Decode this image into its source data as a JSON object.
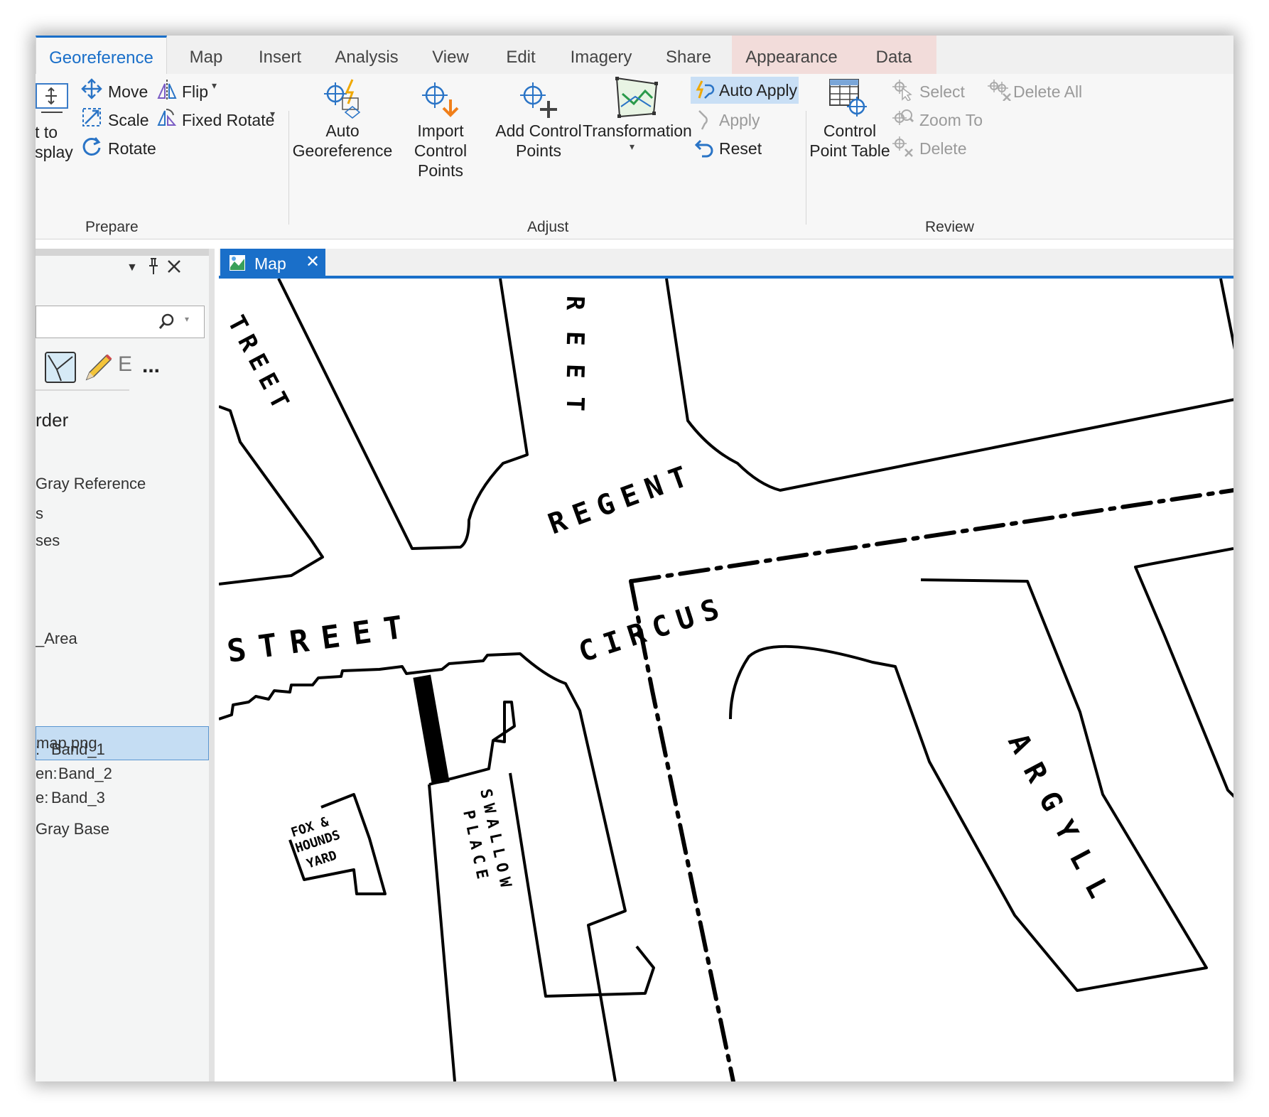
{
  "tabs": [
    "Georeference",
    "Map",
    "Insert",
    "Analysis",
    "View",
    "Edit",
    "Imagery",
    "Share",
    "Appearance",
    "Data"
  ],
  "prepare": {
    "fit_to_display": [
      "it to",
      "isplay"
    ],
    "move": "Move",
    "scale": "Scale",
    "rotate": "Rotate",
    "flip": "Flip",
    "fixed_rotate": "Fixed Rotate",
    "group": "Prepare"
  },
  "adjust": {
    "auto_georeference": [
      "Auto",
      "Georeference"
    ],
    "import_control_points": [
      "Import",
      "Control Points"
    ],
    "add_control_points": [
      "Add Control",
      "Points"
    ],
    "transformation": "Transformation",
    "auto_apply": "Auto Apply",
    "apply": "Apply",
    "reset": "Reset",
    "group": "Adjust"
  },
  "review": {
    "control_point_table": [
      "Control",
      "Point Table"
    ],
    "select": "Select",
    "zoom_to": "Zoom To",
    "delete": "Delete",
    "delete_all": "Delete All",
    "group": "Review"
  },
  "contents": {
    "heading": "rder",
    "items": [
      "Gray Reference",
      "s",
      "ses",
      "_Area",
      "map.png"
    ],
    "bands": [
      {
        "prefix": ":",
        "value": "Band_1"
      },
      {
        "prefix": "en:",
        "value": "Band_2"
      },
      {
        "prefix": "e:",
        "value": "Band_3"
      }
    ],
    "base": "Gray Base",
    "selected_item": "map.png"
  },
  "map_view": {
    "tab_label": "Map",
    "labels": {
      "street_top": [
        "R",
        "E",
        "E",
        "T"
      ],
      "treet_left": "TREET",
      "regent": "REGENT",
      "street": "STREET",
      "circus": "CIRCUS",
      "argyll": "ARGYLL",
      "swallow": "SWALLOW",
      "place": "PLACE",
      "fox": [
        "FOX &",
        "HOUNDS",
        "YARD"
      ]
    }
  },
  "colors": {
    "accent": "#1a6fc9",
    "appearance_tab": "#f2dcda",
    "selection": "#c5ddf3"
  }
}
